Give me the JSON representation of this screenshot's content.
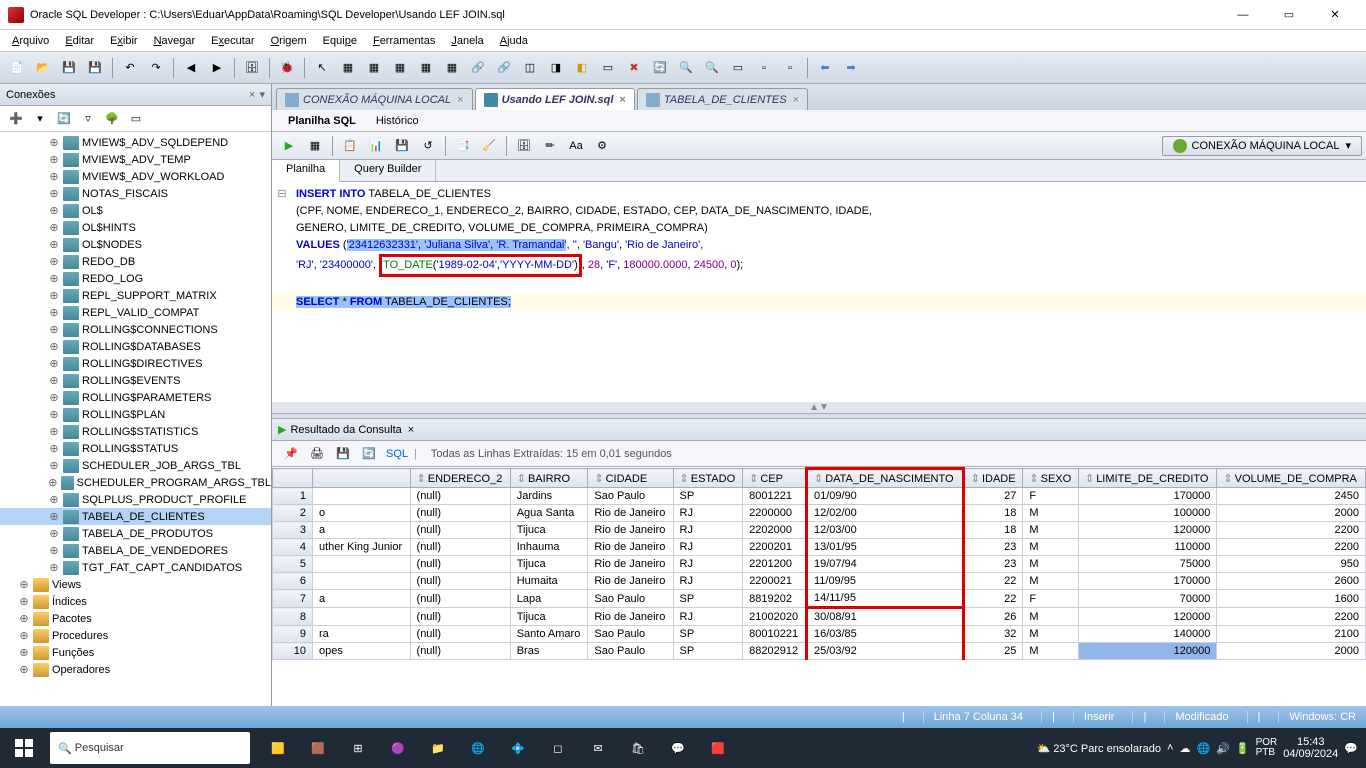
{
  "window": {
    "title": "Oracle SQL Developer : C:\\Users\\Eduar\\AppData\\Roaming\\SQL Developer\\Usando LEF JOIN.sql"
  },
  "menu": [
    "Arquivo",
    "Editar",
    "Exibir",
    "Navegar",
    "Executar",
    "Origem",
    "Equipe",
    "Ferramentas",
    "Janela",
    "Ajuda"
  ],
  "connections_panel": {
    "title": "Conexões",
    "tree": [
      "MVIEW$_ADV_SQLDEPEND",
      "MVIEW$_ADV_TEMP",
      "MVIEW$_ADV_WORKLOAD",
      "NOTAS_FISCAIS",
      "OL$",
      "OL$HINTS",
      "OL$NODES",
      "REDO_DB",
      "REDO_LOG",
      "REPL_SUPPORT_MATRIX",
      "REPL_VALID_COMPAT",
      "ROLLING$CONNECTIONS",
      "ROLLING$DATABASES",
      "ROLLING$DIRECTIVES",
      "ROLLING$EVENTS",
      "ROLLING$PARAMETERS",
      "ROLLING$PLAN",
      "ROLLING$STATISTICS",
      "ROLLING$STATUS",
      "SCHEDULER_JOB_ARGS_TBL",
      "SCHEDULER_PROGRAM_ARGS_TBL",
      "SQLPLUS_PRODUCT_PROFILE",
      "TABELA_DE_CLIENTES",
      "TABELA_DE_PRODUTOS",
      "TABELA_DE_VENDEDORES",
      "TGT_FAT_CAPT_CANDIDATOS"
    ],
    "folders": [
      "Views",
      "Índices",
      "Pacotes",
      "Procedures",
      "Funções",
      "Operadores"
    ]
  },
  "editor_tabs": [
    {
      "label": "CONEXÃO MÁQUINA LOCAL",
      "active": false
    },
    {
      "label": "Usando LEF JOIN.sql",
      "active": true
    },
    {
      "label": "TABELA_DE_CLIENTES",
      "active": false
    }
  ],
  "sub_tabs": {
    "a": "Planilha SQL",
    "b": "Histórico"
  },
  "ws_tabs": {
    "a": "Planilha",
    "b": "Query Builder"
  },
  "connection_badge": "CONEXÃO MÁQUINA LOCAL",
  "code": {
    "l1": "INSERT INTO TABELA_DE_CLIENTES",
    "l2": "(CPF, NOME, ENDERECO_1, ENDERECO_2, BAIRRO, CIDADE, ESTADO, CEP, DATA_DE_NASCIMENTO, IDADE,",
    "l3": "GENERO, LIMITE_DE_CREDITO, VOLUME_DE_COMPRA, PRIMEIRA_COMPRA)",
    "l4a": "VALUES ",
    "l4b": "(",
    "l4c": "'23412632331'",
    "l4d": ", ",
    "l4e": "'Juliana Silva'",
    "l4f": ", ",
    "l4g": "'R. Tramandai'",
    "l4h": ", ",
    "l4i": "''",
    "l4j": ", ",
    "l4k": "'Bangu'",
    "l4l": ", ",
    "l4m": "'Rio de Janeiro'",
    "l4n": ",",
    "l5a": "'RJ'",
    "l5b": ", ",
    "l5c": "'23400000'",
    "l5d": ", ",
    "l5e": "TO_DATE('1989-02-04','YYYY-MM-DD')",
    "l5f": ", ",
    "l5g": "28",
    "l5h": ", ",
    "l5i": "'F'",
    "l5j": ", ",
    "l5k": "180000.0000",
    "l5l": ", ",
    "l5m": "24500",
    "l5n": ", ",
    "l5o": "0",
    "l5p": ");",
    "l7": "SELECT * FROM TABELA_DE_CLIENTES;"
  },
  "result": {
    "tab": "Resultado da Consulta",
    "info": "Todas as Linhas Extraídas: 15 em 0,01 segundos",
    "sql_link": "SQL",
    "columns": [
      "",
      "ENDERECO_2",
      "BAIRRO",
      "CIDADE",
      "ESTADO",
      "CEP",
      "DATA_DE_NASCIMENTO",
      "IDADE",
      "SEXO",
      "LIMITE_DE_CREDITO",
      "VOLUME_DE_COMPRA"
    ],
    "rows": [
      {
        "n": 1,
        "c": [
          "",
          "(null)",
          "Jardins",
          "Sao Paulo",
          "SP",
          "8001221",
          "01/09/90",
          "27",
          "F",
          "170000",
          "2450"
        ]
      },
      {
        "n": 2,
        "c": [
          "o",
          "(null)",
          "Agua Santa",
          "Rio de Janeiro",
          "RJ",
          "2200000",
          "12/02/00",
          "18",
          "M",
          "100000",
          "2000"
        ]
      },
      {
        "n": 3,
        "c": [
          "a",
          "(null)",
          "Tijuca",
          "Rio de Janeiro",
          "RJ",
          "2202000",
          "12/03/00",
          "18",
          "M",
          "120000",
          "2200"
        ]
      },
      {
        "n": 4,
        "c": [
          "uther King Junior",
          "(null)",
          "Inhauma",
          "Rio de Janeiro",
          "RJ",
          "2200201",
          "13/01/95",
          "23",
          "M",
          "110000",
          "2200"
        ]
      },
      {
        "n": 5,
        "c": [
          "",
          "(null)",
          "Tijuca",
          "Rio de Janeiro",
          "RJ",
          "2201200",
          "19/07/94",
          "23",
          "M",
          "75000",
          "950"
        ]
      },
      {
        "n": 6,
        "c": [
          "",
          "(null)",
          "Humaita",
          "Rio de Janeiro",
          "RJ",
          "2200021",
          "11/09/95",
          "22",
          "M",
          "170000",
          "2600"
        ]
      },
      {
        "n": 7,
        "c": [
          "a",
          "(null)",
          "Lapa",
          "Sao Paulo",
          "SP",
          "8819202",
          "14/11/95",
          "22",
          "F",
          "70000",
          "1600"
        ]
      },
      {
        "n": 8,
        "c": [
          "",
          "(null)",
          "Tijuca",
          "Rio de Janeiro",
          "RJ",
          "21002020",
          "30/08/91",
          "26",
          "M",
          "120000",
          "2200"
        ]
      },
      {
        "n": 9,
        "c": [
          "ra",
          "(null)",
          "Santo Amaro",
          "Sao Paulo",
          "SP",
          "80010221",
          "16/03/85",
          "32",
          "M",
          "140000",
          "2100"
        ]
      },
      {
        "n": 10,
        "c": [
          "opes",
          "(null)",
          "Bras",
          "Sao Paulo",
          "SP",
          "88202912",
          "25/03/92",
          "25",
          "M",
          "120000",
          "2000"
        ]
      }
    ]
  },
  "statusbar": {
    "cursor": "Linha 7 Coluna 34",
    "mode": "Inserir",
    "state": "Modificado",
    "os": "Windows: CR"
  },
  "taskbar": {
    "search": "Pesquisar",
    "weather": "23°C  Parc ensolarado",
    "date": "04/09/2024",
    "time": "15:43",
    "lang": "POR\nPTB"
  }
}
